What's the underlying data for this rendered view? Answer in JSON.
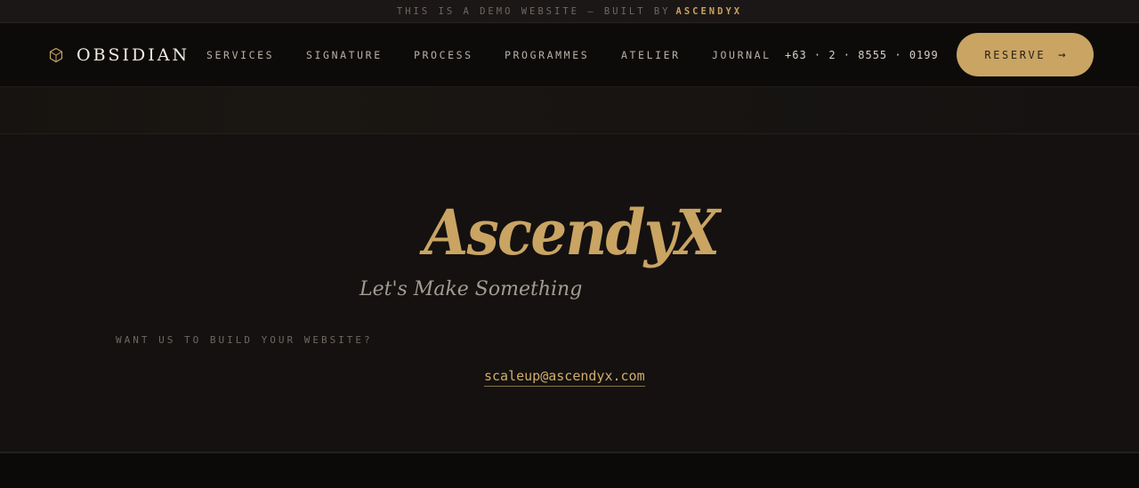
{
  "topbar": {
    "text": "THIS IS A DEMO WEBSITE — BUILT BY",
    "brand": "ASCENDYX"
  },
  "nav": {
    "logo_icon": "hexagon-cube-icon",
    "logo_text": "OBSIDIAN",
    "links": [
      "SERVICES",
      "SIGNATURE",
      "PROCESS",
      "PROGRAMMES",
      "ATELIER",
      "JOURNAL"
    ],
    "phone": "+63 · 2 · 8555 · 0199",
    "reserve_label": "RESERVE",
    "reserve_icon": "arrow-right-icon"
  },
  "hero": {
    "title": "AscendyX",
    "subtitle": "Let's Make Something",
    "question": "WANT US TO BUILD YOUR WEBSITE?",
    "email": "scaleup@ascendyx.com"
  },
  "colors": {
    "background": "#141110",
    "nav_background": "#0d0b0a",
    "accent": "#c9a463",
    "text_light": "#f2ece2",
    "text_muted": "#6f6862"
  }
}
